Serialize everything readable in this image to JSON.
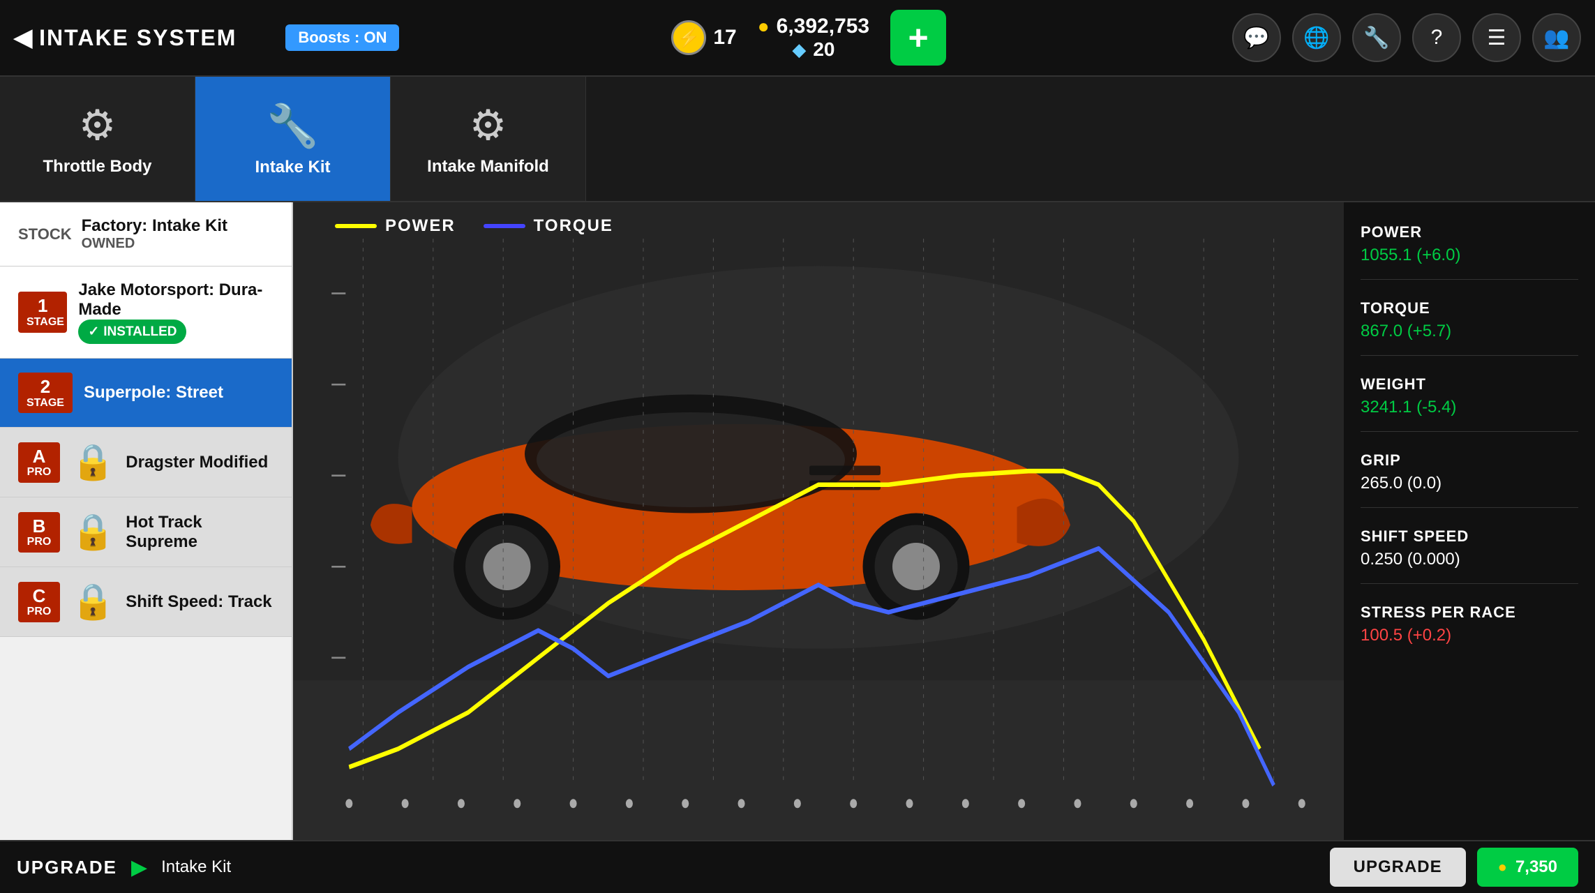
{
  "header": {
    "back_label": "INTAKE SYSTEM",
    "boost_label": "Boosts : ON",
    "lightning_count": "17",
    "gold_amount": "6,392,753",
    "gem_amount": "20",
    "add_label": "+",
    "icons": [
      "💬",
      "🌐",
      "🔧",
      "?",
      "☰",
      "👥"
    ]
  },
  "tabs": [
    {
      "label": "Throttle Body",
      "active": false,
      "icon": "⚙"
    },
    {
      "label": "Intake Kit",
      "active": true,
      "icon": "🔴"
    },
    {
      "label": "Intake Manifold",
      "active": false,
      "icon": "⚙"
    }
  ],
  "upgrades": [
    {
      "stage": "STOCK",
      "name": "Factory: Intake Kit",
      "sub": "OWNED",
      "status": "owned",
      "locked": false,
      "active": false
    },
    {
      "stage": "1\nSTAGE",
      "name": "Jake Motorsport: Dura-Made",
      "sub": "",
      "status": "installed",
      "locked": false,
      "active": false
    },
    {
      "stage": "2\nSTAGE",
      "name": "Superpole: Street",
      "sub": "",
      "status": "selected",
      "locked": false,
      "active": true
    },
    {
      "stage": "A\nPRO",
      "name": "Dragster Modified",
      "sub": "",
      "status": "locked",
      "locked": true,
      "active": false
    },
    {
      "stage": "B\nPRO",
      "name": "Hot Track Supreme",
      "sub": "",
      "status": "locked",
      "locked": true,
      "active": false
    },
    {
      "stage": "C\nPRO",
      "name": "Shift Speed: Track",
      "sub": "",
      "status": "locked",
      "locked": true,
      "active": false
    }
  ],
  "chart": {
    "power_label": "POWER",
    "torque_label": "TORQUE",
    "power_color": "#ffff00",
    "torque_color": "#4444ff"
  },
  "stats": [
    {
      "name": "POWER",
      "value": "1055.1 (+6.0)",
      "type": "positive"
    },
    {
      "name": "TORQUE",
      "value": "867.0 (+5.7)",
      "type": "positive"
    },
    {
      "name": "WEIGHT",
      "value": "3241.1 (-5.4)",
      "type": "positive"
    },
    {
      "name": "GRIP",
      "value": "265.0 (0.0)",
      "type": "neutral"
    },
    {
      "name": "SHIFT SPEED",
      "value": "0.250 (0.000)",
      "type": "neutral"
    },
    {
      "name": "STRESS PER RACE",
      "value": "100.5 (+0.2)",
      "type": "negative"
    }
  ],
  "bottom": {
    "upgrade_label": "UPGRADE",
    "item_name": "Intake Kit",
    "upgrade_btn": "UPGRADE",
    "price": "7,350"
  }
}
